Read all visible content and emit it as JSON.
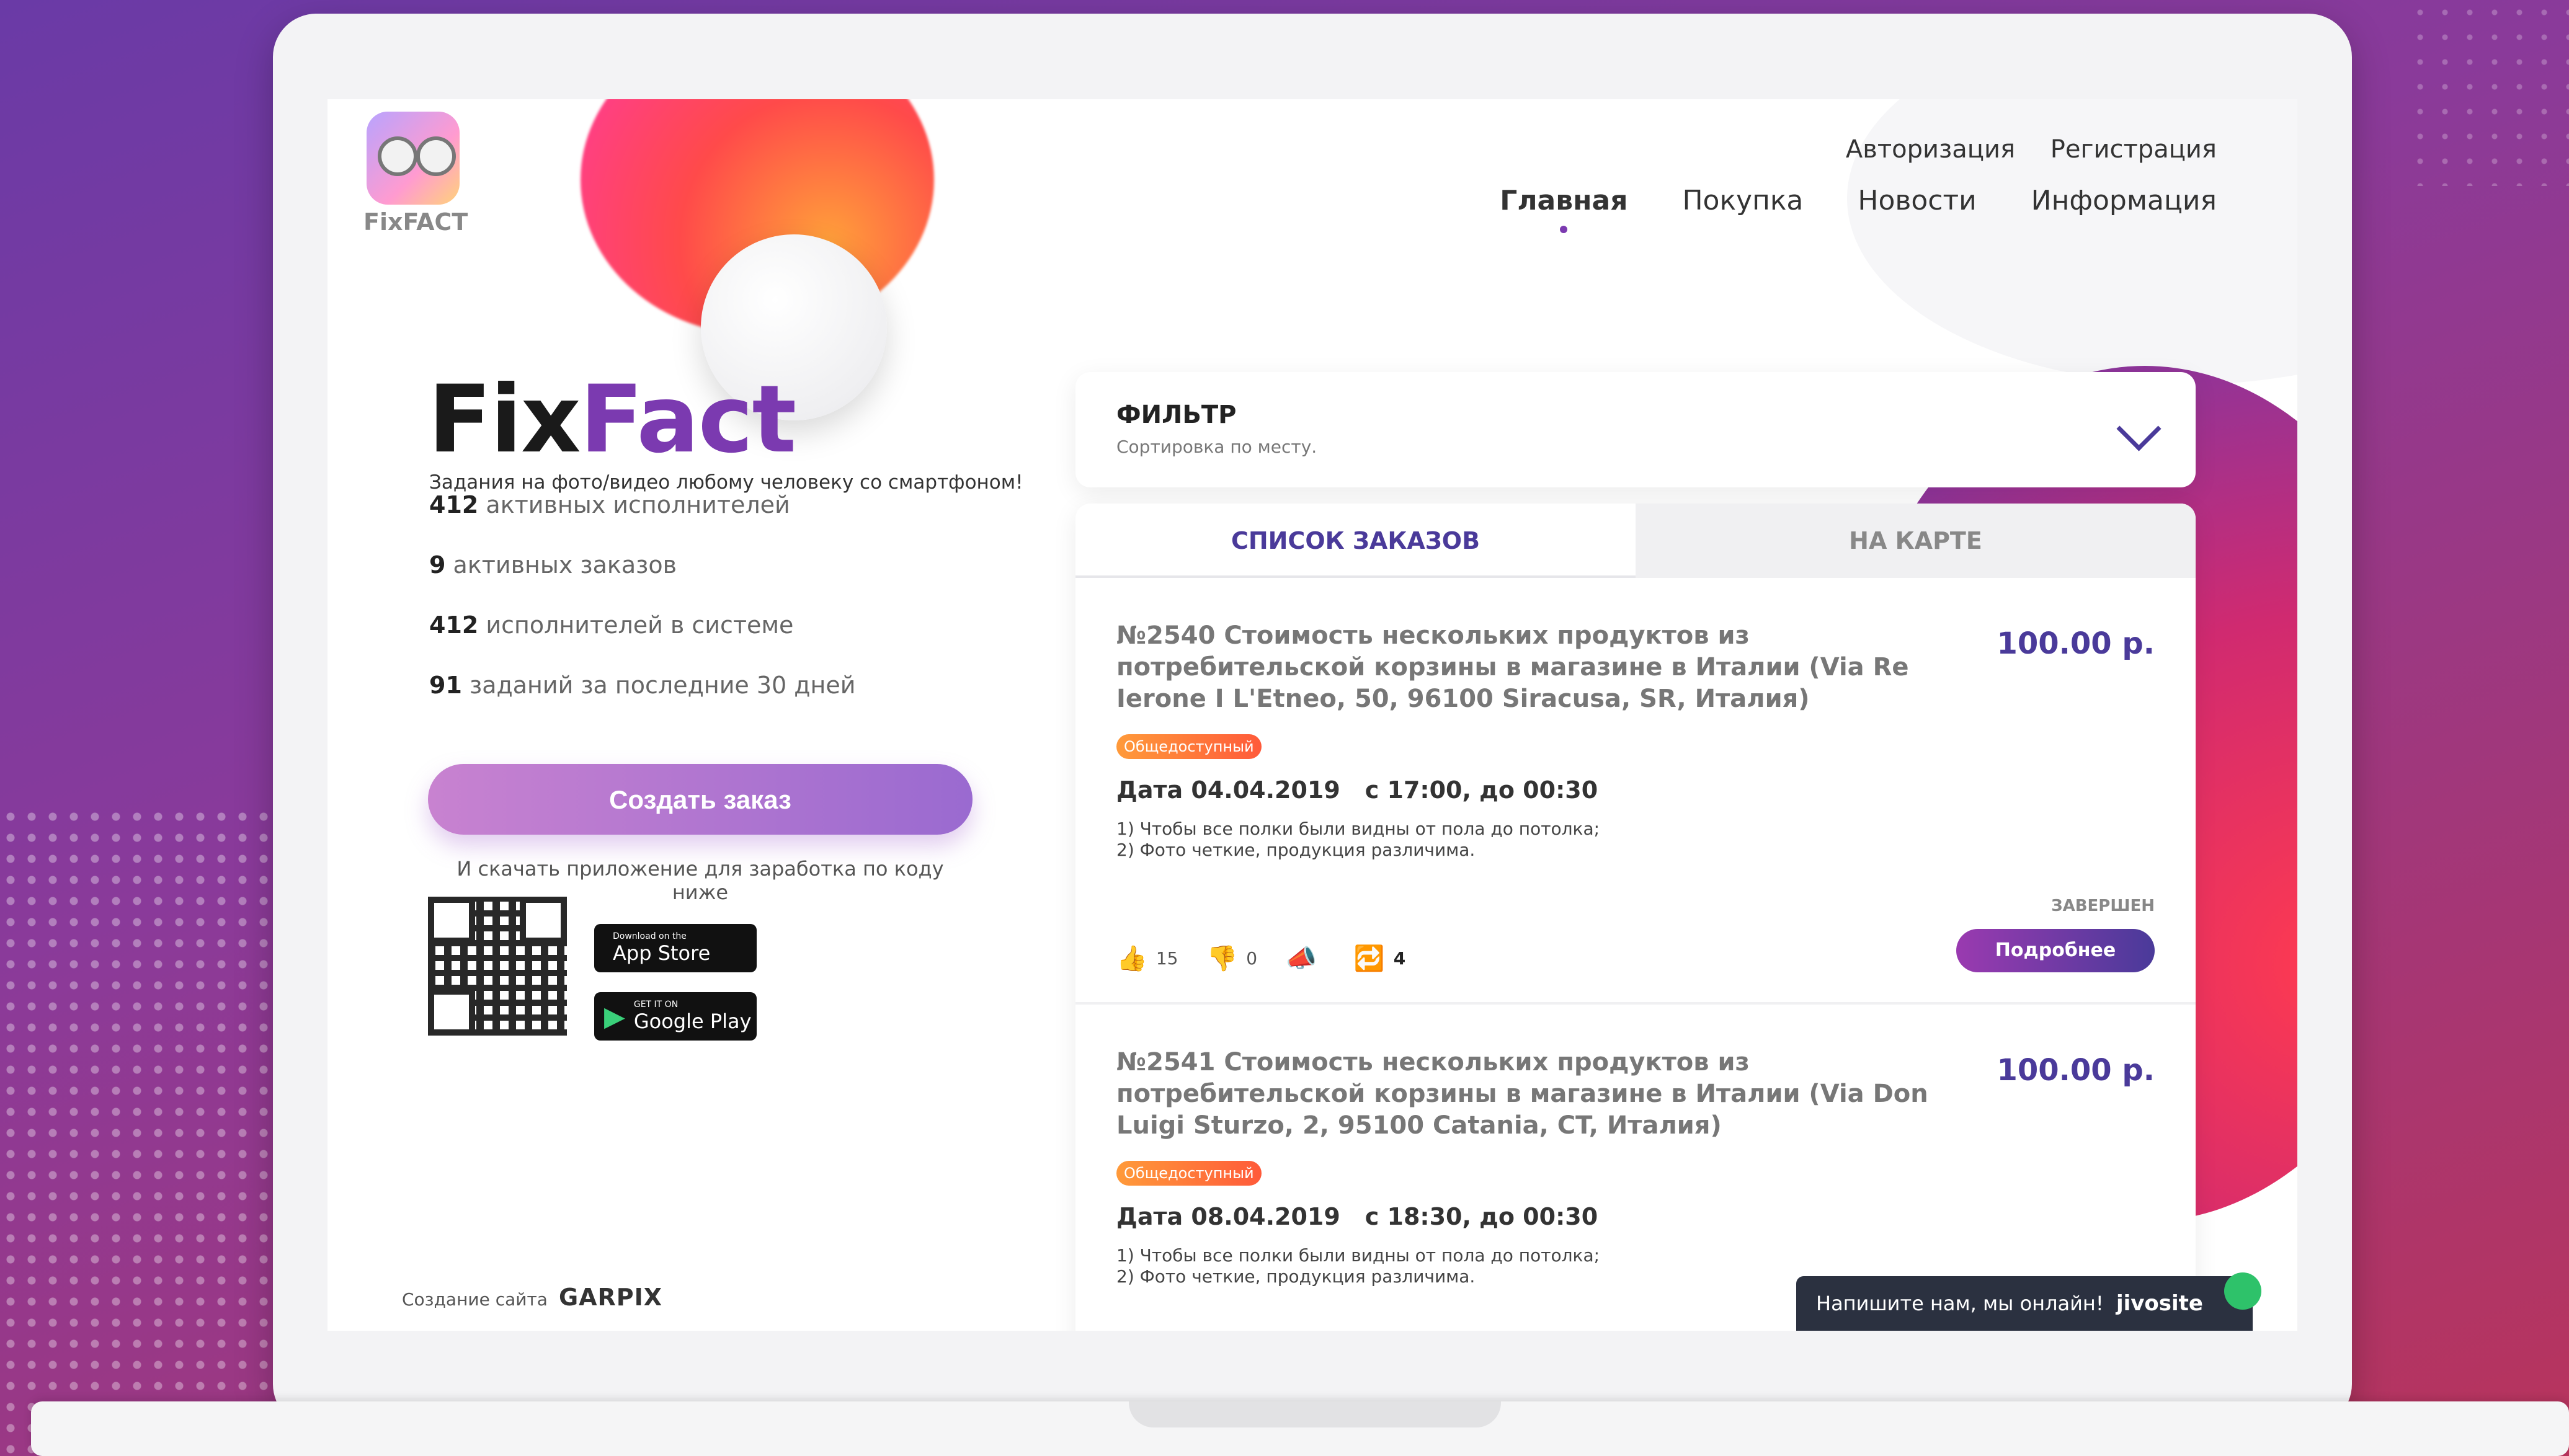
{
  "header": {
    "logo_text": "FixFACT",
    "auth_links": [
      "Авторизация",
      "Регистрация"
    ],
    "nav": [
      {
        "label": "Главная",
        "active": true
      },
      {
        "label": "Покупка",
        "active": false
      },
      {
        "label": "Новости",
        "active": false
      },
      {
        "label": "Информация",
        "active": false
      }
    ]
  },
  "hero": {
    "brand_fix": "Fix",
    "brand_fact": "Fact",
    "tagline": "Задания на фото/видео любому человеку со смартфоном!",
    "stats": [
      {
        "value": "412",
        "label": "активных исполнителей"
      },
      {
        "value": "9",
        "label": "активных заказов"
      },
      {
        "value": "412",
        "label": "исполнителей в системе"
      },
      {
        "value": "91",
        "label": "заданий за последние 30 дней"
      }
    ],
    "create_button": "Создать заказ",
    "download_text": "И скачать приложение для заработка по коду ниже",
    "app_store": {
      "small": "Download on the",
      "big": "App Store"
    },
    "google_play": {
      "small": "GET IT ON",
      "big": "Google Play"
    }
  },
  "credits": {
    "label": "Создание сайта",
    "brand": "GARPIX"
  },
  "filter": {
    "title": "ФИЛЬТР",
    "subtitle": "Сортировка по месту."
  },
  "tabs": {
    "list": "СПИСОК ЗАКАЗОВ",
    "map": "НА КАРТЕ"
  },
  "orders": [
    {
      "title": "№2540 Стоимость нескольких продуктов из потребительской корзины в магазине в Италии (Via Re Ierone I L'Etneo, 50, 96100 Siracusa, SR, Италия)",
      "price": "100.00 р.",
      "badge": "Общедоступный",
      "date": "Дата 04.04.2019",
      "time": "с 17:00, до 00:30",
      "req1": "1) Чтобы все полки были видны от пола до потолка;",
      "req2": "2) Фото четкие, продукция различима.",
      "status": "ЗАВЕРШЕН",
      "details": "Подробнее",
      "likes": "15",
      "dislikes": "0",
      "reposts": "4"
    },
    {
      "title": "№2541 Стоимость нескольких продуктов из потребительской корзины в магазине в Италии (Via Don Luigi Sturzo, 2, 95100 Catania, CT, Италия)",
      "price": "100.00 р.",
      "badge": "Общедоступный",
      "date": "Дата 08.04.2019",
      "time": "с 18:30, до 00:30",
      "req1": "1) Чтобы все полки были видны от пола до потолка;",
      "req2": "2) Фото четкие, продукция различима."
    }
  ],
  "chat": {
    "text": "Напишите нам, мы онлайн!",
    "brand": "jivosite"
  }
}
